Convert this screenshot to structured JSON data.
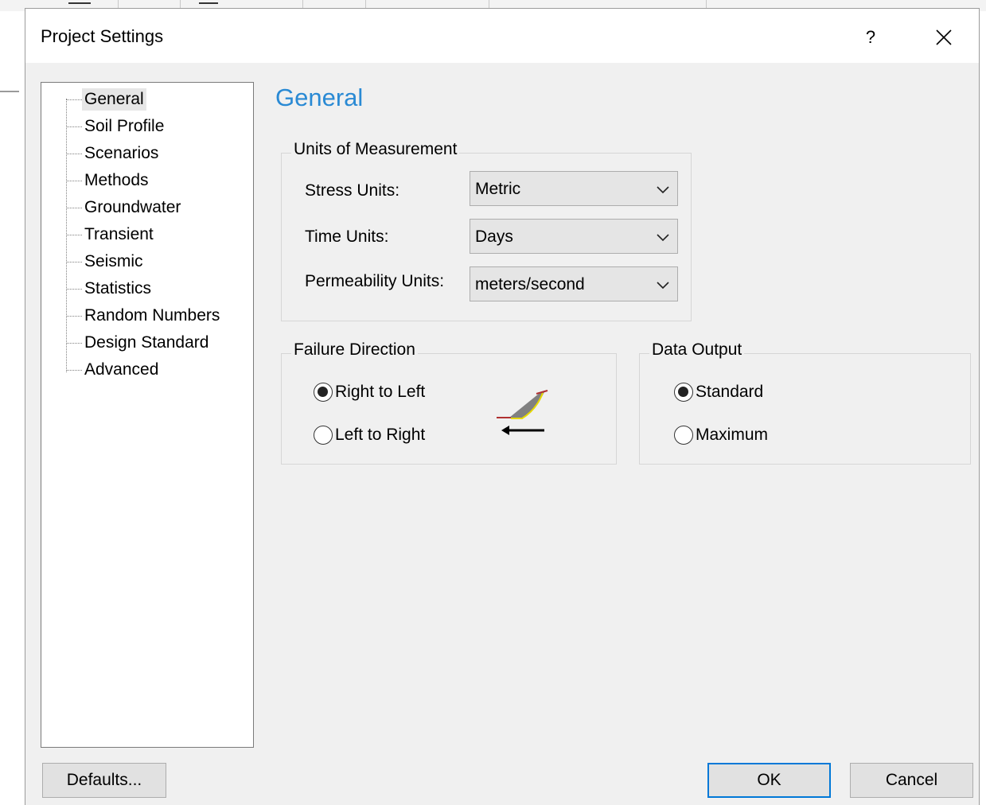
{
  "dialog": {
    "title": "Project Settings",
    "help_label": "?"
  },
  "tree": {
    "items": [
      {
        "label": "General"
      },
      {
        "label": "Soil Profile"
      },
      {
        "label": "Scenarios"
      },
      {
        "label": "Methods"
      },
      {
        "label": "Groundwater"
      },
      {
        "label": "Transient"
      },
      {
        "label": "Seismic"
      },
      {
        "label": "Statistics"
      },
      {
        "label": "Random Numbers"
      },
      {
        "label": "Design Standard"
      },
      {
        "label": "Advanced"
      }
    ],
    "selected": "General"
  },
  "section": {
    "title": "General"
  },
  "units": {
    "legend": "Units of Measurement",
    "stress_label": "Stress Units:",
    "stress_value": "Metric",
    "time_label": "Time Units:",
    "time_value": "Days",
    "permeability_label": "Permeability Units:",
    "permeability_value": "meters/second"
  },
  "failure_direction": {
    "legend": "Failure Direction",
    "option1": "Right to Left",
    "option2": "Left to Right",
    "selected": "Right to Left",
    "icon": "slope-failure-icon"
  },
  "data_output": {
    "legend": "Data Output",
    "option1": "Standard",
    "option2": "Maximum",
    "selected": "Standard"
  },
  "buttons": {
    "defaults": "Defaults...",
    "ok": "OK",
    "cancel": "Cancel"
  },
  "colors": {
    "section_title": "#2a8ad4",
    "default_button_border": "#0078d7",
    "slope_fill": "#808080",
    "slip_surface": "#e6d800",
    "ground_line": "#b03030"
  }
}
